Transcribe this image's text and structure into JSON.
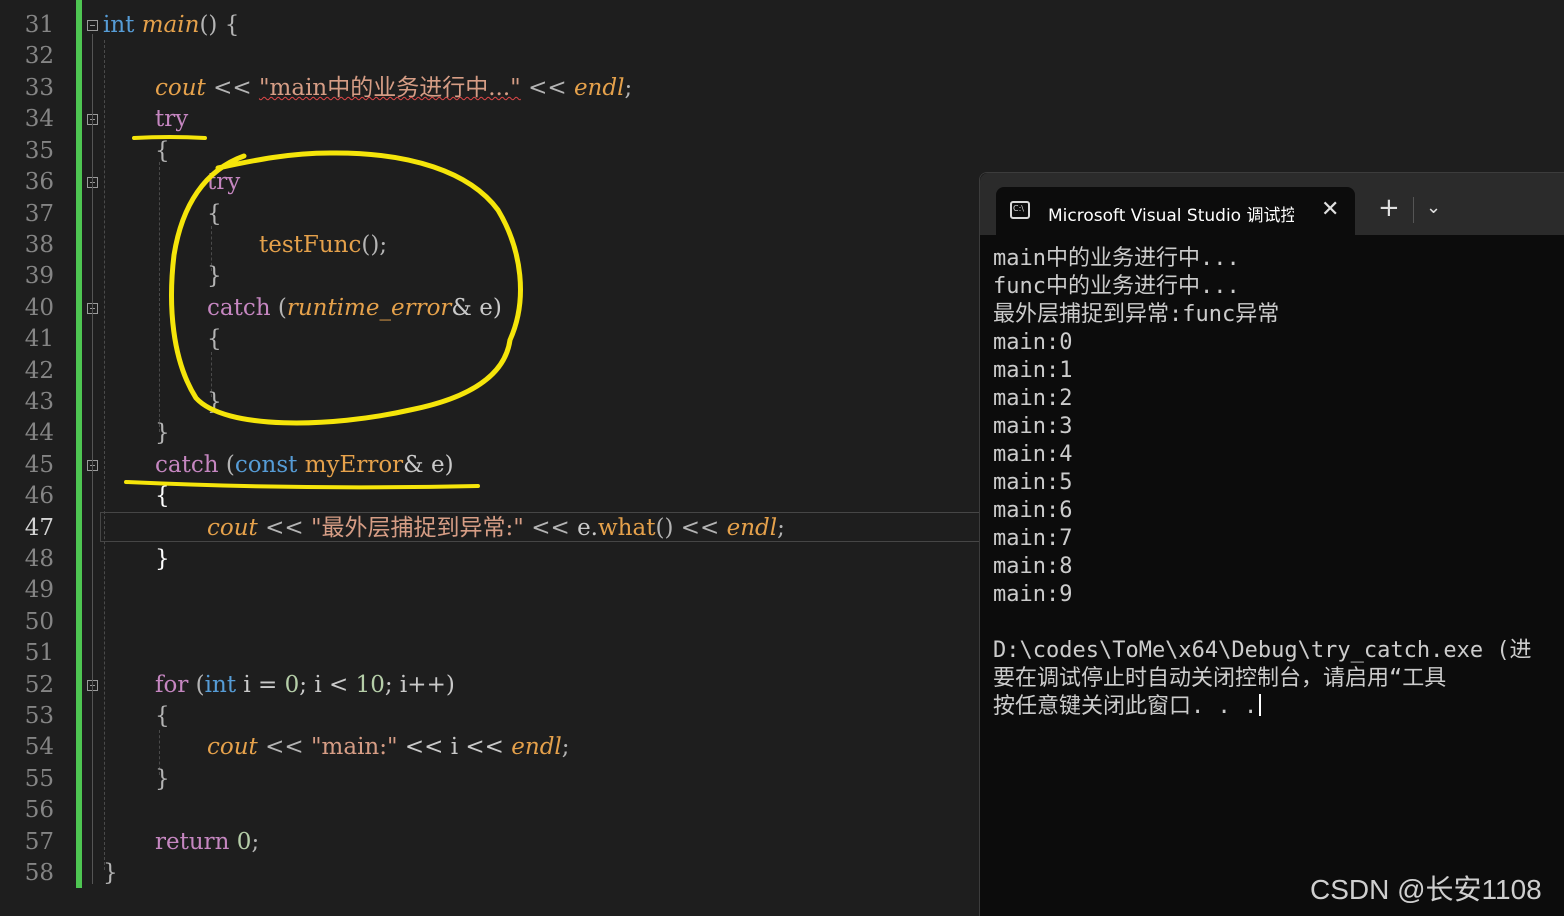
{
  "editor": {
    "line_numbers": [
      "31",
      "32",
      "33",
      "34",
      "35",
      "36",
      "37",
      "38",
      "39",
      "40",
      "41",
      "42",
      "43",
      "44",
      "45",
      "46",
      "47",
      "48",
      "49",
      "50",
      "51",
      "52",
      "53",
      "54",
      "55",
      "56",
      "57",
      "58"
    ],
    "current_line": "47",
    "code": {
      "l31": {
        "int": "int",
        "main": "main",
        "rest": "() {"
      },
      "l33": {
        "cout": "cout",
        "op1": " << ",
        "str": "\"main中的业务进行中...\"",
        "op2": " << ",
        "endl": "endl",
        "semi": ";"
      },
      "l34": {
        "try": "try"
      },
      "l35": {
        "brace": "{"
      },
      "l36": {
        "try": "try"
      },
      "l37": {
        "brace": "{"
      },
      "l38": {
        "fn": "testFunc",
        "rest": "();"
      },
      "l39": {
        "brace": "}"
      },
      "l40": {
        "catch": "catch",
        "p1": " (",
        "type": "runtime_error",
        "rest": "& e)"
      },
      "l41": {
        "brace": "{"
      },
      "l43": {
        "brace": "}"
      },
      "l44": {
        "brace": "}"
      },
      "l45": {
        "catch": "catch",
        "p1": " (",
        "const": "const",
        "sp": " ",
        "type": "myError",
        "rest": "& e)"
      },
      "l46": {
        "brace": "{"
      },
      "l47": {
        "cout": "cout",
        "op1": " << ",
        "str": "\"最外层捕捉到异常:\"",
        "op2": " << ",
        "e": "e.",
        "what": "what",
        "paren": "()",
        "op3": " << ",
        "endl": "endl",
        "semi": ";"
      },
      "l48": {
        "brace": "}"
      },
      "l52": {
        "for": "for",
        "p1": " (",
        "int": "int",
        "a": " i = ",
        "zero": "0",
        "b": "; i < ",
        "ten": "10",
        "c": "; i++)"
      },
      "l53": {
        "brace": "{"
      },
      "l54": {
        "cout": "cout",
        "op1": " << ",
        "str": "\"main:\"",
        "op2": " << i << ",
        "endl": "endl",
        "semi": ";"
      },
      "l55": {
        "brace": "}"
      },
      "l57": {
        "ret": "return",
        "sp": " ",
        "zero": "0",
        "semi": ";"
      },
      "l58": {
        "brace": "}"
      }
    }
  },
  "terminal": {
    "tab_title": "Microsoft Visual Studio 调试控制台",
    "close_glyph": "✕",
    "new_tab_glyph": "+",
    "dropdown_glyph": "⌄",
    "lines": [
      "main中的业务进行中...",
      "func中的业务进行中...",
      "最外层捕捉到异常:func异常",
      "main:0",
      "main:1",
      "main:2",
      "main:3",
      "main:4",
      "main:5",
      "main:6",
      "main:7",
      "main:8",
      "main:9",
      "",
      "D:\\codes\\ToMe\\x64\\Debug\\try_catch.exe (进",
      "要在调试停止时自动关闭控制台，请启用“工具",
      "按任意键关闭此窗口. . ."
    ]
  },
  "watermark": "CSDN @长安1108",
  "colors": {
    "accent_annotation": "#f5e50a",
    "gutter_change": "#4ec552",
    "background": "#1e1e1e"
  }
}
